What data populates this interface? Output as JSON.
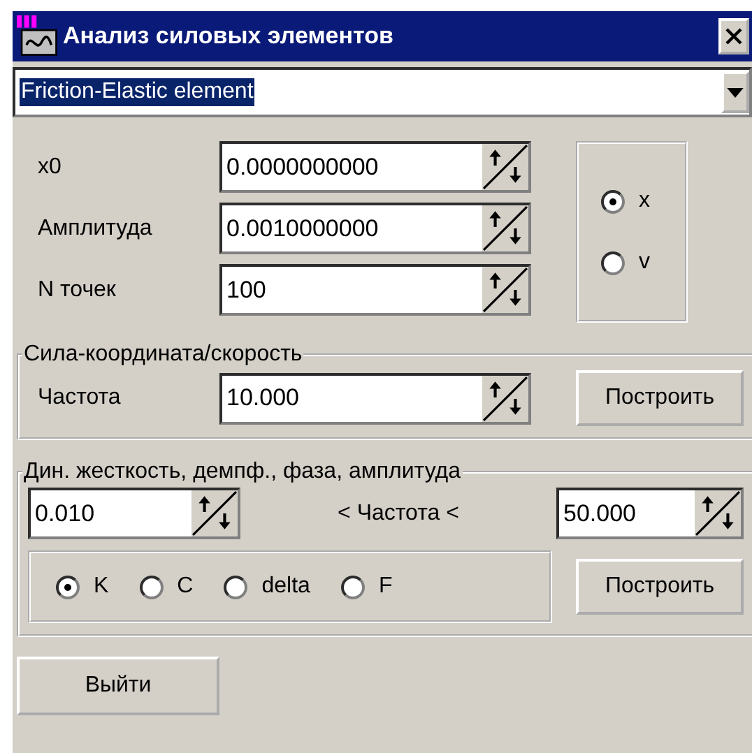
{
  "window": {
    "title": "Анализ силовых элементов"
  },
  "element_select": {
    "value": "Friction-Elastic element"
  },
  "params": [
    {
      "label": "x0",
      "value": "0.0000000000"
    },
    {
      "label": "Амплитуда",
      "value": "0.0010000000"
    },
    {
      "label": "N точек",
      "value": "100"
    }
  ],
  "mode": [
    {
      "label": "x",
      "selected": true
    },
    {
      "label": "v",
      "selected": false
    }
  ],
  "force_section": {
    "title": "Сила-координата/скорость",
    "label": "Частота",
    "value": "10.000",
    "button": "Построить"
  },
  "dyn_section": {
    "title": "Дин. жесткость, демпф., фаза, амплитуда",
    "from": "0.010",
    "range_label": "< Частота <",
    "to": "50.000",
    "options": [
      {
        "label": "K",
        "selected": true
      },
      {
        "label": "C",
        "selected": false
      },
      {
        "label": "delta",
        "selected": false
      },
      {
        "label": "F",
        "selected": false
      }
    ],
    "button": "Построить"
  },
  "exit_button": "Выйти"
}
